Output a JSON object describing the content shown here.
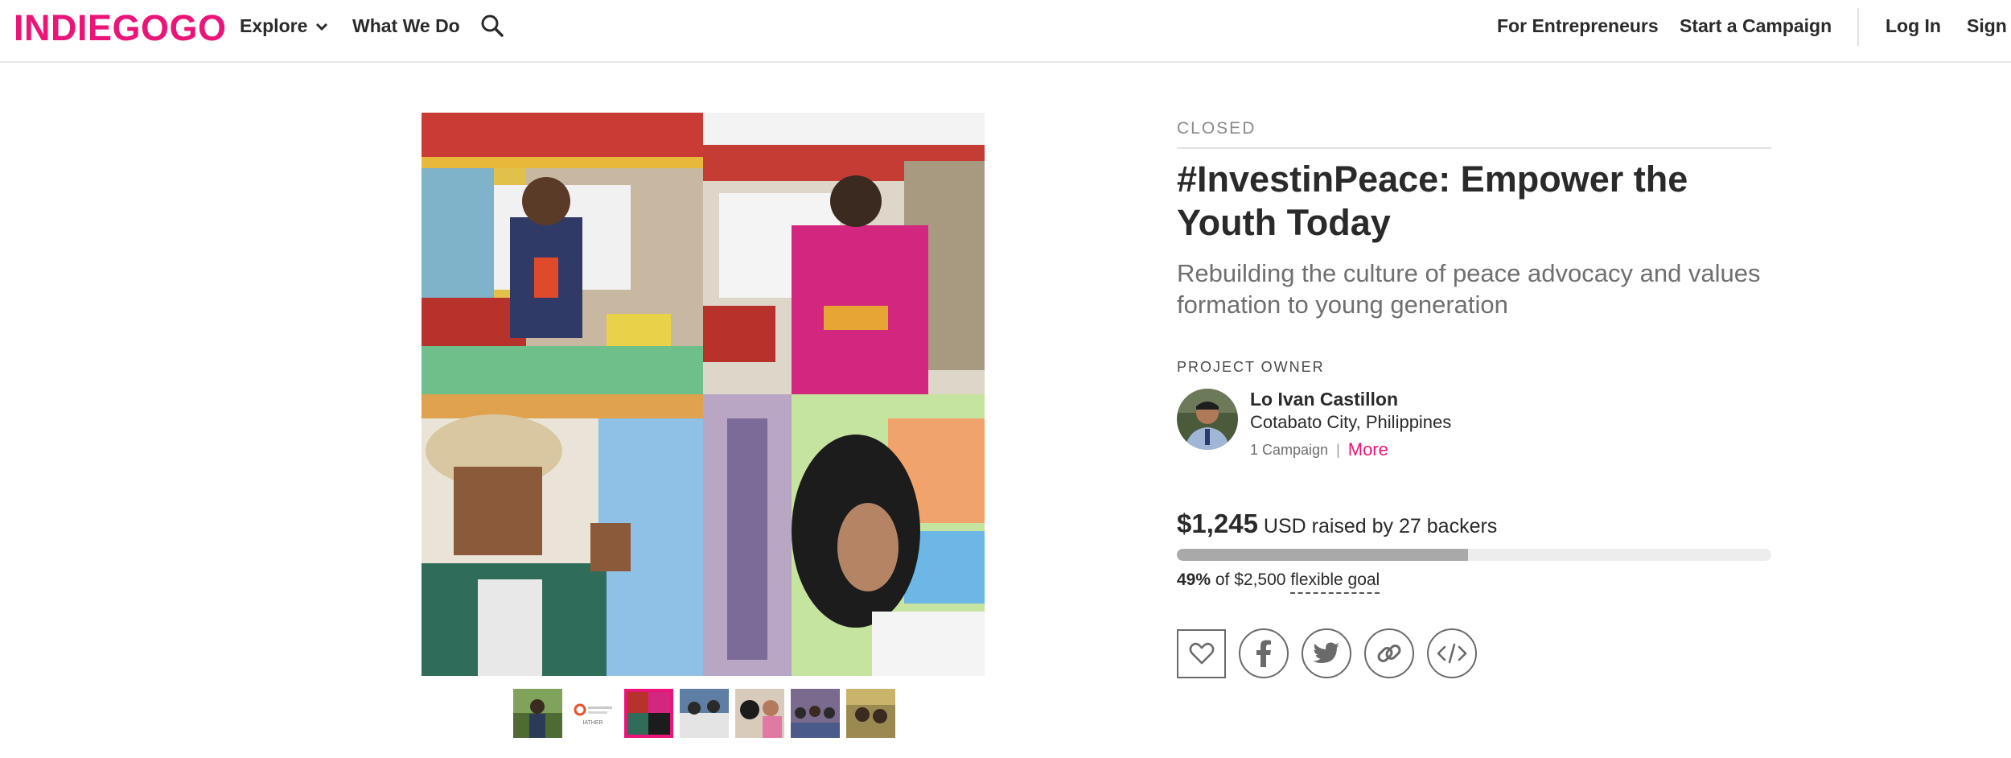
{
  "header": {
    "logo": "INDIEGOGO",
    "nav": {
      "explore": "Explore",
      "what_we_do": "What We Do",
      "for_entrepreneurs": "For Entrepreneurs",
      "start_campaign": "Start a Campaign",
      "log_in": "Log In",
      "sign_up": "Sign"
    },
    "icons": [
      "chevron-down-icon",
      "search-icon"
    ]
  },
  "gallery": {
    "thumbnail_count": 7,
    "active_thumbnail": 3,
    "thumbnail_logo_text": "IATHER"
  },
  "campaign": {
    "status": "CLOSED",
    "title": "#InvestinPeace: Empower the Youth Today",
    "tagline": "Rebuilding the culture of peace advocacy and values formation to young generation"
  },
  "owner": {
    "label": "PROJECT OWNER",
    "name": "Lo Ivan Castillon",
    "location": "Cotabato City, Philippines",
    "campaigns": "1 Campaign",
    "separator": "|",
    "more": "More"
  },
  "funding": {
    "amount": "$1,245",
    "raised_text": "USD raised by 27 backers",
    "percent_label": "49%",
    "goal_text": "of $2,500",
    "goal_type": "flexible goal",
    "progress": 0.49
  },
  "actions": [
    "heart-icon",
    "facebook-icon",
    "twitter-icon",
    "link-icon",
    "embed-icon"
  ],
  "colors": {
    "brand": "#eb1478",
    "text": "#2a2a2a",
    "muted": "#6f6f6f",
    "progress_fill": "#a9a9a9",
    "progress_track": "#ededed"
  }
}
